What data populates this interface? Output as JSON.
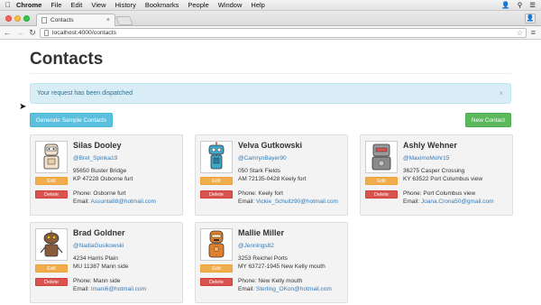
{
  "menubar": {
    "items": [
      "Chrome",
      "File",
      "Edit",
      "View",
      "History",
      "Bookmarks",
      "People",
      "Window",
      "Help"
    ]
  },
  "browser": {
    "tab_title": "Contacts",
    "url": "localhost:4000/contacts"
  },
  "page": {
    "title": "Contacts",
    "alert": "Your request has been dispatched",
    "alert_close": "×",
    "generate_label": "Generate Sample Contacts",
    "new_contact_label": "New Contact"
  },
  "labels": {
    "edit": "Edit",
    "delete": "Delete",
    "phone_prefix": "Phone:",
    "email_prefix": "Email:"
  },
  "contacts": [
    {
      "name": "Silas Dooley",
      "handle": "@Bret_Spinka19",
      "address_line1": "95650 Buster Bridge",
      "address_line2": "KP 47228 Osborne furt",
      "phone": "Osborne furt",
      "email": "Assunta88@hotmail.com",
      "avatar_color": "#f2e2c9",
      "avatar_icon": "beige-robot-icon"
    },
    {
      "name": "Velva Gutkowski",
      "handle": "@CamrynBayer90",
      "address_line1": "050 Stark Fields",
      "address_line2": "AM 72135-0428 Keely fort",
      "phone": "Keely fort",
      "email": "Vickie_Schultz90@hotmail.com",
      "avatar_color": "#3fa7c9",
      "avatar_icon": "blue-robot-icon"
    },
    {
      "name": "Ashly Wehner",
      "handle": "@MaximoMohr15",
      "address_line1": "36275 Casper Crossing",
      "address_line2": "KY 63522 Port Columbus view",
      "phone": "Port Columbus view",
      "email": "Joana.Crona50@gmail.com",
      "avatar_color": "#9a9a9a",
      "avatar_icon": "gray-robot-icon"
    },
    {
      "name": "Brad Goldner",
      "handle": "@NadiaGusikowski",
      "address_line1": "4234 Harris Plain",
      "address_line2": "MU 11387 Mann side",
      "phone": "Mann side",
      "email": "Imani6@hotmail.com",
      "avatar_color": "#8a5a3c",
      "avatar_icon": "brown-robot-icon"
    },
    {
      "name": "Mallie Miller",
      "handle": "@Jennings82",
      "address_line1": "3253 Reichel Ports",
      "address_line2": "MY 63727-1945 New Kelly mouth",
      "phone": "New Kelly mouth",
      "email": "Sterling_OKon@hotmail.com",
      "avatar_color": "#e0802a",
      "avatar_icon": "orange-robot-icon"
    }
  ]
}
